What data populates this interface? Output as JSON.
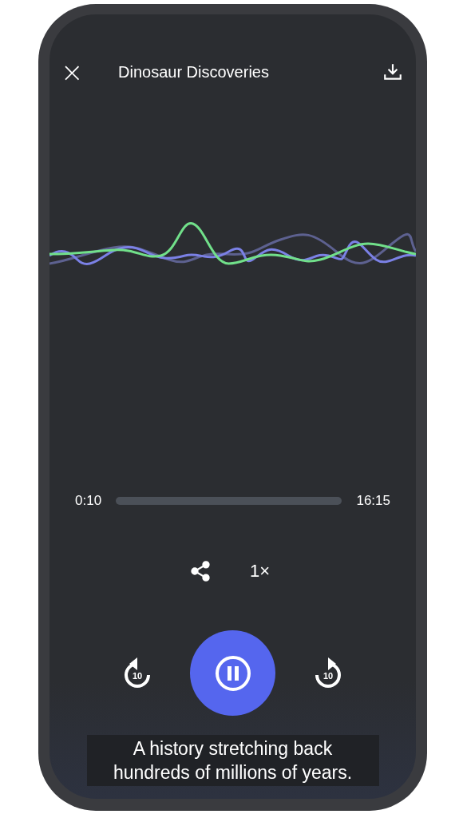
{
  "header": {
    "close_icon": "×",
    "title": "Dinosaur Discoveries"
  },
  "progress": {
    "elapsed": "0:10",
    "total": "16:15"
  },
  "speed": "1×",
  "controls": {
    "skip_back": "10",
    "skip_forward": "10",
    "playing": true
  },
  "caption": {
    "lines": [
      "A history stretching back",
      "hundreds of millions of years."
    ]
  }
}
